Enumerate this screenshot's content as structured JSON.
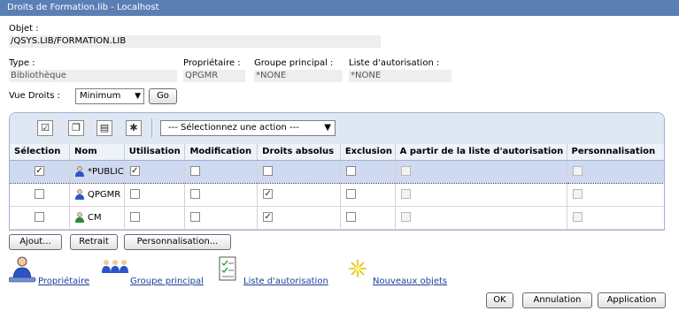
{
  "window": {
    "title": "Droits de Formation.lib - Localhost"
  },
  "object": {
    "label": "Objet :",
    "value": "/QSYS.LIB/FORMATION.LIB"
  },
  "info": {
    "type_label": "Type :",
    "type_value": "Bibliothèque",
    "owner_label": "Propriétaire :",
    "owner_value": "QPGMR",
    "group_label": "Groupe principal :",
    "group_value": "*NONE",
    "authlist_label": "Liste d'autorisation :",
    "authlist_value": "*NONE"
  },
  "view": {
    "label": "Vue Droits :",
    "selected": "Minimum",
    "go_label": "Go"
  },
  "toolbar": {
    "action_select": "--- Sélectionnez une action ---"
  },
  "table": {
    "headers": [
      "Sélection",
      "Nom",
      "Utilisation",
      "Modification",
      "Droits absolus",
      "Exclusion",
      "A partir de la liste d'autorisation",
      "Personnalisation"
    ],
    "rows": [
      {
        "name": "*PUBLIC",
        "selected": true,
        "use": true,
        "modify": false,
        "absolute": false,
        "exclude": false,
        "from_list": false,
        "custom": false
      },
      {
        "name": "QPGMR",
        "selected": false,
        "use": false,
        "modify": false,
        "absolute": true,
        "exclude": false,
        "from_list": false,
        "custom": false
      },
      {
        "name": "CM",
        "selected": false,
        "use": false,
        "modify": false,
        "absolute": true,
        "exclude": false,
        "from_list": false,
        "custom": false
      }
    ]
  },
  "buttons": {
    "add": "Ajout...",
    "remove": "Retrait",
    "custom": "Personnalisation...",
    "ok": "OK",
    "cancel": "Annulation",
    "apply": "Application"
  },
  "links": {
    "owner": "Propriétaire",
    "group": "Groupe principal",
    "authlist": "Liste d'autorisation",
    "newobj": "Nouveaux objets"
  },
  "colors": {
    "title_bar": "#5a7fb5",
    "selected_row": "#cfd9f0",
    "link": "#1a3f9a"
  },
  "icons": [
    "user-icon",
    "group-icon",
    "checklist-icon",
    "new-star-icon"
  ]
}
